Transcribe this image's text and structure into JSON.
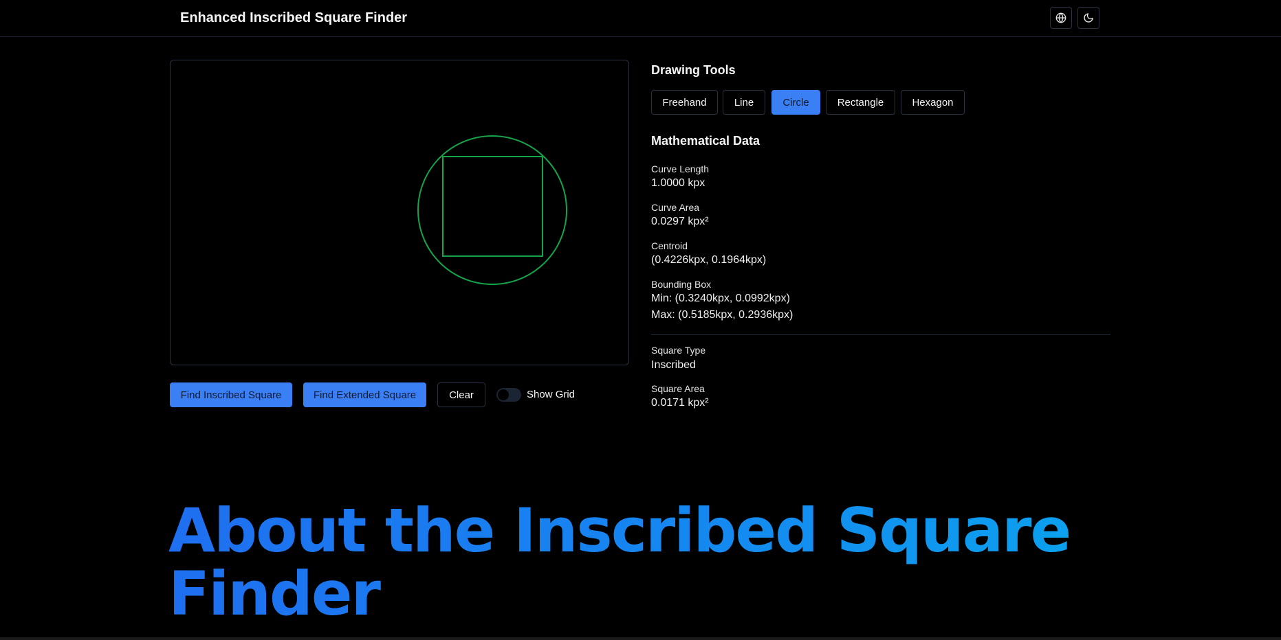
{
  "header": {
    "title": "Enhanced Inscribed Square Finder",
    "language_icon": "globe-icon",
    "theme_icon": "moon-icon"
  },
  "canvas": {
    "shape": "circle",
    "stroke_color": "#16a34a"
  },
  "actions": {
    "find_inscribed": "Find Inscribed Square",
    "find_extended": "Find Extended Square",
    "clear": "Clear",
    "show_grid_label": "Show Grid",
    "show_grid_on": false
  },
  "tools": {
    "title": "Drawing Tools",
    "items": [
      {
        "label": "Freehand",
        "active": false
      },
      {
        "label": "Line",
        "active": false
      },
      {
        "label": "Circle",
        "active": true
      },
      {
        "label": "Rectangle",
        "active": false
      },
      {
        "label": "Hexagon",
        "active": false
      }
    ]
  },
  "math": {
    "title": "Mathematical Data",
    "curve_length_label": "Curve Length",
    "curve_length_value": "1.0000 kpx",
    "curve_area_label": "Curve Area",
    "curve_area_value": "0.0297 kpx²",
    "centroid_label": "Centroid",
    "centroid_value": "(0.4226kpx, 0.1964kpx)",
    "bbox_label": "Bounding Box",
    "bbox_min": "Min: (0.3240kpx, 0.0992kpx)",
    "bbox_max": "Max: (0.5185kpx, 0.2936kpx)",
    "square_type_label": "Square Type",
    "square_type_value": "Inscribed",
    "square_area_label": "Square Area",
    "square_area_value": "0.0171 kpx²"
  },
  "about": {
    "heading": "About the Inscribed Square Finder"
  },
  "colors": {
    "accent": "#3b7ff5",
    "background": "#000000",
    "shape_stroke": "#16a34a"
  }
}
